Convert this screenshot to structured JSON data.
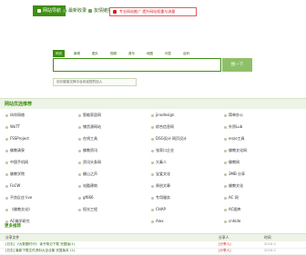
{
  "topnav": {
    "tabs": [
      {
        "label": "网站导航"
      },
      {
        "label": "最新收录"
      },
      {
        "label": "友情链接"
      }
    ],
    "promo": "专业网站推广 提升网站权重与流量"
  },
  "search": {
    "tabs": [
      "网页",
      "新闻",
      "图片",
      "视频",
      "音乐",
      "地图",
      "问答",
      "百科"
    ],
    "placeholder": "",
    "button": "搜一下",
    "hint": "站长链接交换平台欢迎您的加入"
  },
  "links_panel": {
    "title": "网站优选推荐",
    "items": [
      "伙伴网络",
      "智能家居网",
      "jinxdesign",
      "简单办公",
      "WoTT",
      "铺货源网站",
      "综合信息网",
      "外贸Lub",
      "FSSProject",
      "在线工具",
      "DSG设计 网页设计",
      "enzo工具",
      "佛教清泉",
      "佛教资讯",
      "张家口企业",
      "佛教文化网",
      "中国手机网",
      "资讯头条网",
      "大秦人",
      "佛教网",
      "佛教学院",
      "佛山之声",
      "宝爱文化",
      "3MB 分享",
      "FoCW",
      "站酷建筑",
      "原创文章",
      "佛教文化",
      "不良反应 live",
      "gf666",
      "专用服务",
      "AC 网",
      "《佛教文化》",
      "阳光工程",
      "CHAP",
      "AC图库",
      "AC佛学研究",
      "",
      "Alex",
      "cnhide"
    ]
  },
  "more": {
    "title": "更多推荐"
  },
  "table": {
    "headers": [
      "分享文件",
      "分享人",
      "时间"
    ],
    "rows": [
      {
        "file": "[日志] 《大数据时代》 读书笔记下载 完整版(1)",
        "user": "[分享人]",
        "time": "2016-0"
      },
      {
        "file": "[日志] 最新下载文件资料大全合集 完整版本 (2)",
        "user": "[分享人]",
        "time": "2016-0"
      }
    ]
  }
}
